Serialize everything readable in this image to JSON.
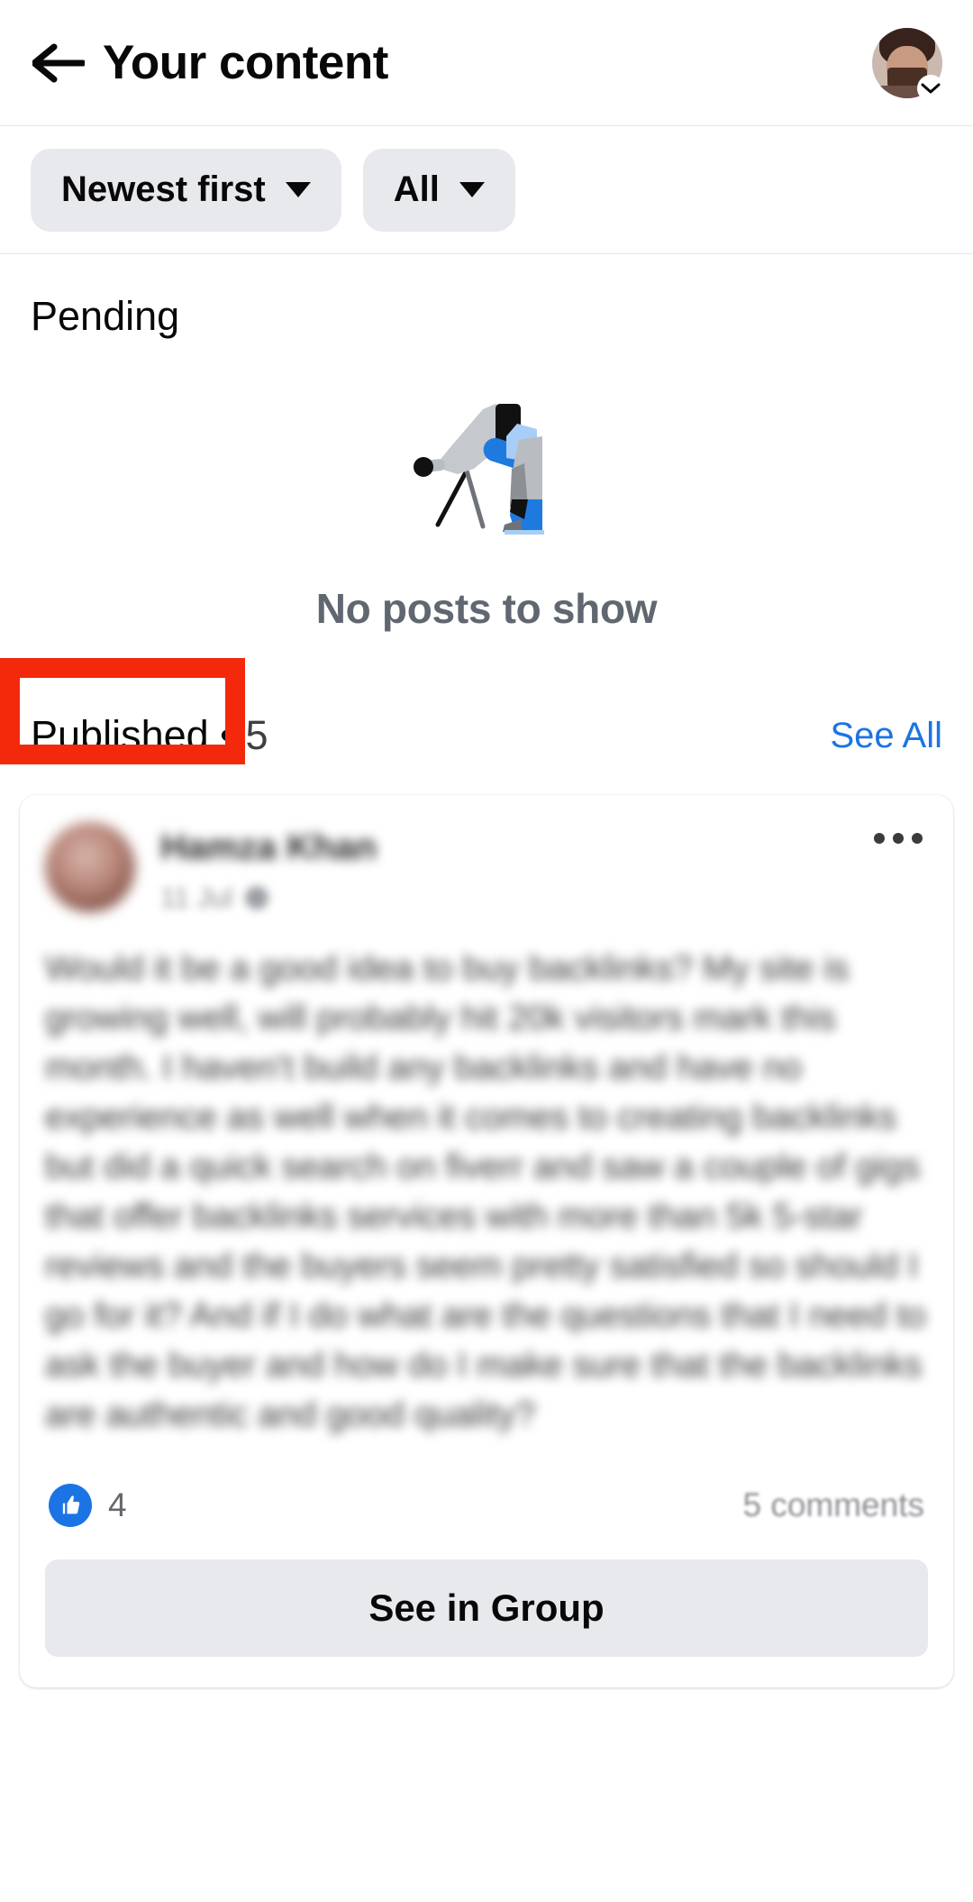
{
  "header": {
    "title": "Your content",
    "back_icon": "back-arrow-icon",
    "avatar_icon": "profile-avatar",
    "avatar_chevron_icon": "chevron-down-icon"
  },
  "filters": [
    {
      "label": "Newest first",
      "icon": "chevron-down-icon"
    },
    {
      "label": "All",
      "icon": "chevron-down-icon"
    }
  ],
  "pending": {
    "heading": "Pending",
    "empty_text": "No posts to show",
    "illustration_icon": "telescope-illustration"
  },
  "published": {
    "heading": "Published",
    "separator": "•",
    "count": "5",
    "see_all_label": "See All",
    "annotation_color": "#f4290c",
    "link_color": "#1b74e4"
  },
  "post": {
    "author": "Hamza Khan",
    "timestamp": "11 Jul",
    "audience_icon": "globe-icon",
    "menu_icon": "more-options-icon",
    "body": "Would it be a good idea to buy backlinks? My site is growing well, will probably hit 20k visitors mark this month. I haven't build any backlinks and have no experience as well when it comes to creating backlinks but did a quick search on fiverr and saw a couple of gigs that offer backlinks services with more than 5k 5-star reviews and the buyers seem pretty satisfied so should I go for it? And if I do what are the questions that I need to ask the buyer and how do I make sure that the backlinks are authentic and good quality?",
    "reaction_icon": "thumbs-up-icon",
    "reaction_count": "4",
    "comment_count": "5 comments",
    "see_in_group_label": "See in Group"
  }
}
